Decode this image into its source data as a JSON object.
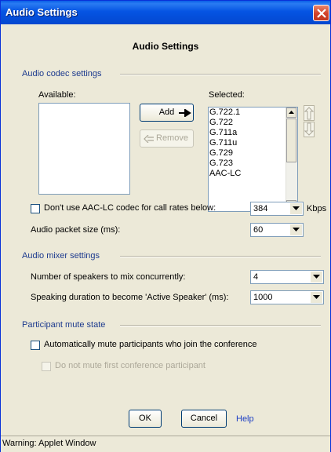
{
  "window": {
    "title": "Audio Settings"
  },
  "heading": "Audio Settings",
  "codec": {
    "section_label": "Audio codec settings",
    "available_label": "Available:",
    "selected_label": "Selected:",
    "available_items": [],
    "selected_items": [
      "G.722.1",
      "G.722",
      "G.711a",
      "G.711u",
      "G.729",
      "G.723",
      "AAC-LC"
    ],
    "add_label": "Add",
    "remove_label": "Remove",
    "dont_use_aac_label": "Don't use AAC-LC codec for call rates below:",
    "dont_use_aac_checked": false,
    "call_rate_value": "384",
    "call_rate_unit": "Kbps",
    "packet_size_label": "Audio packet size (ms):",
    "packet_size_value": "60"
  },
  "mixer": {
    "section_label": "Audio mixer settings",
    "speakers_label": "Number of speakers to mix concurrently:",
    "speakers_value": "4",
    "speaking_duration_label": "Speaking duration to become 'Active Speaker' (ms):",
    "speaking_duration_value": "1000"
  },
  "mute": {
    "section_label": "Participant mute state",
    "auto_mute_label": "Automatically mute participants who join the conference",
    "auto_mute_checked": false,
    "first_participant_label": "Do not mute first conference participant",
    "first_participant_checked": false
  },
  "footer": {
    "ok_label": "OK",
    "cancel_label": "Cancel",
    "help_label": "Help"
  },
  "status_bar": "Warning: Applet Window",
  "colors": {
    "title_bar": "#0554e3",
    "section_text": "#1c3a8e",
    "link": "#1d3fc4",
    "dialog_bg": "#ece9d8"
  }
}
